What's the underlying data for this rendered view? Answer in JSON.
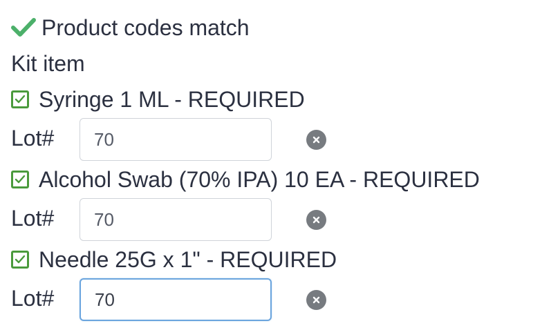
{
  "status": {
    "icon": "checkmark-icon",
    "text": "Product codes match",
    "color": "#4cb06a"
  },
  "section": {
    "label": "Kit item"
  },
  "items": [
    {
      "label": "Syringe 1 ML - REQUIRED",
      "checked": true,
      "lot_label": "Lot#",
      "lot_value": "70",
      "clear_icon": "clear-icon"
    },
    {
      "label": "Alcohol Swab (70% IPA) 10 EA - REQUIRED",
      "checked": true,
      "lot_label": "Lot#",
      "lot_value": "70",
      "clear_icon": "clear-icon"
    },
    {
      "label": "Needle 25G x 1\" - REQUIRED",
      "checked": true,
      "lot_label": "Lot#",
      "lot_value": "70",
      "clear_icon": "clear-icon"
    }
  ],
  "colors": {
    "checkbox_border": "#4a9a3c",
    "focus_border": "#6aa4de",
    "clear_button": "#777b80"
  }
}
